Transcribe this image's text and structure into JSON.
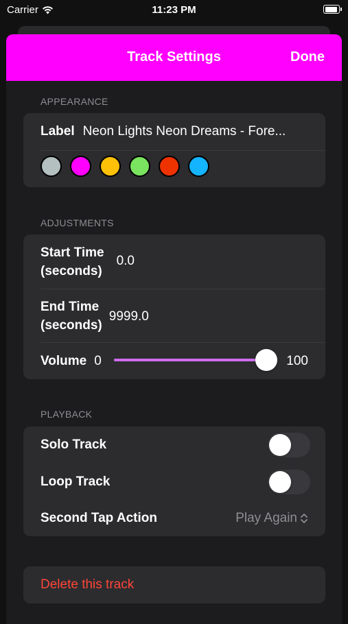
{
  "status": {
    "carrier": "Carrier",
    "time": "11:23 PM"
  },
  "nav": {
    "title": "Track Settings",
    "done_label": "Done",
    "bar_color": "#ff00ff"
  },
  "appearance": {
    "header": "APPEARANCE",
    "label_key": "Label",
    "label_value": "Neon Lights Neon Dreams - Fore...",
    "colors": [
      "#b4bfbf",
      "#ff00ff",
      "#ffc107",
      "#7ae35f",
      "#ee3300",
      "#14b4ff"
    ],
    "selected_color": "#ff00ff"
  },
  "adjustments": {
    "header": "ADJUSTMENTS",
    "start_time_label_1": "Start Time",
    "start_time_label_2": "(seconds)",
    "start_time_value": "0.0",
    "end_time_label_1": "End Time",
    "end_time_label_2": "(seconds)",
    "end_time_value": "9999.0",
    "volume_label": "Volume",
    "volume_min": "0",
    "volume_max": "100",
    "volume_level": 100
  },
  "playback": {
    "header": "PLAYBACK",
    "solo_label": "Solo Track",
    "solo_on": false,
    "loop_label": "Loop Track",
    "loop_on": false,
    "second_tap_label": "Second Tap Action",
    "second_tap_value": "Play Again"
  },
  "danger": {
    "delete_label": "Delete this track",
    "delete_color": "#ff453a"
  }
}
